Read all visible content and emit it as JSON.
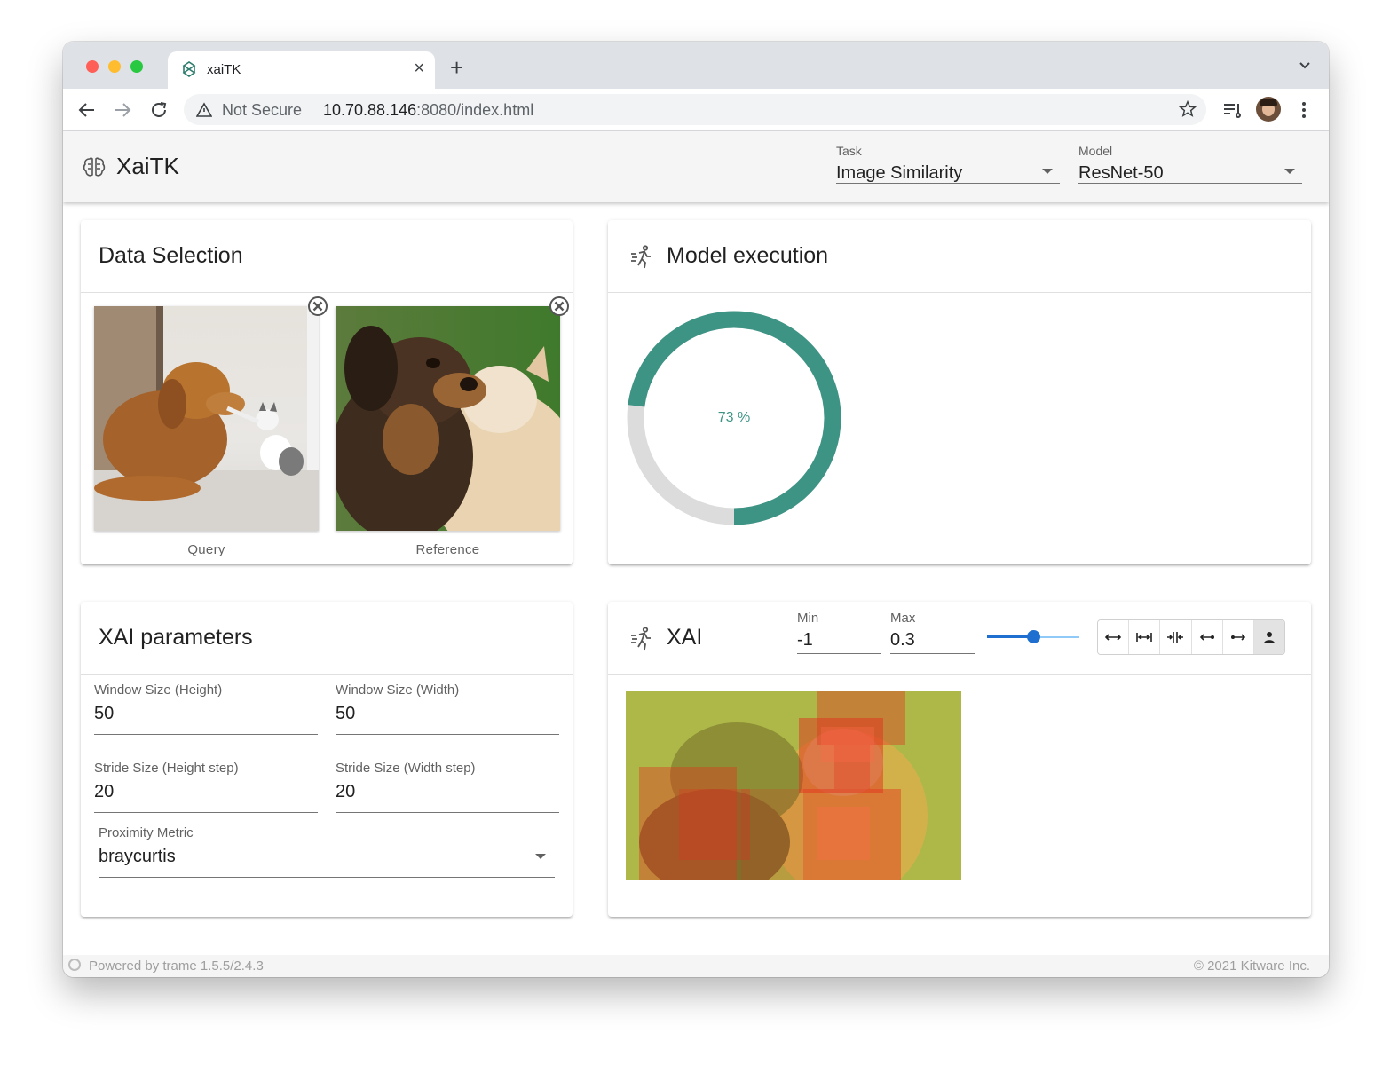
{
  "browser": {
    "tab_title": "xaiTK",
    "tab_close": "×",
    "new_tab": "+",
    "security_label": "Not Secure",
    "url_host": "10.70.88.146",
    "url_path": ":8080/index.html"
  },
  "app": {
    "brand": "XaiTK",
    "task_label": "Task",
    "task_value": "Image Similarity",
    "model_label": "Model",
    "model_value": "ResNet-50"
  },
  "data_selection": {
    "title": "Data Selection",
    "images": [
      {
        "caption": "Query"
      },
      {
        "caption": "Reference"
      }
    ]
  },
  "model_execution": {
    "title": "Model execution",
    "progress_text": "73 %",
    "progress_value": 0.73,
    "progress_color": "#3d9384"
  },
  "xai_parameters": {
    "title": "XAI parameters",
    "window_height": {
      "label": "Window Size (Height)",
      "value": "50"
    },
    "window_width": {
      "label": "Window Size (Width)",
      "value": "50"
    },
    "stride_height": {
      "label": "Stride Size (Height step)",
      "value": "20"
    },
    "stride_width": {
      "label": "Stride Size (Width step)",
      "value": "20"
    },
    "proximity": {
      "label": "Proximity Metric",
      "value": "braycurtis"
    }
  },
  "xai": {
    "title": "XAI",
    "min_label": "Min",
    "min_value": "-1",
    "max_label": "Max",
    "max_value": "0.3",
    "slider_value": 0.5,
    "toolbar_buttons": [
      "expand-horizontal-icon",
      "fit-width-icon",
      "compress-icon",
      "arrow-left-right-icon",
      "arrow-both-icon",
      "person-icon"
    ]
  },
  "footer": {
    "powered_by": "Powered by trame 1.5.5/2.4.3",
    "copyright": "© 2021 Kitware Inc."
  }
}
